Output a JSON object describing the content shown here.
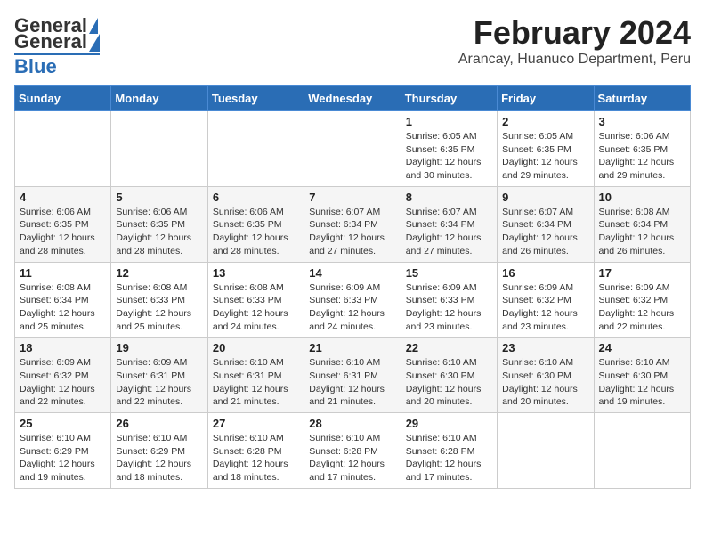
{
  "logo": {
    "general": "General",
    "blue": "Blue"
  },
  "title": "February 2024",
  "subtitle": "Arancay, Huanuco Department, Peru",
  "days_header": [
    "Sunday",
    "Monday",
    "Tuesday",
    "Wednesday",
    "Thursday",
    "Friday",
    "Saturday"
  ],
  "weeks": [
    [
      {
        "day": "",
        "detail": ""
      },
      {
        "day": "",
        "detail": ""
      },
      {
        "day": "",
        "detail": ""
      },
      {
        "day": "",
        "detail": ""
      },
      {
        "day": "1",
        "detail": "Sunrise: 6:05 AM\nSunset: 6:35 PM\nDaylight: 12 hours\nand 30 minutes."
      },
      {
        "day": "2",
        "detail": "Sunrise: 6:05 AM\nSunset: 6:35 PM\nDaylight: 12 hours\nand 29 minutes."
      },
      {
        "day": "3",
        "detail": "Sunrise: 6:06 AM\nSunset: 6:35 PM\nDaylight: 12 hours\nand 29 minutes."
      }
    ],
    [
      {
        "day": "4",
        "detail": "Sunrise: 6:06 AM\nSunset: 6:35 PM\nDaylight: 12 hours\nand 28 minutes."
      },
      {
        "day": "5",
        "detail": "Sunrise: 6:06 AM\nSunset: 6:35 PM\nDaylight: 12 hours\nand 28 minutes."
      },
      {
        "day": "6",
        "detail": "Sunrise: 6:06 AM\nSunset: 6:35 PM\nDaylight: 12 hours\nand 28 minutes."
      },
      {
        "day": "7",
        "detail": "Sunrise: 6:07 AM\nSunset: 6:34 PM\nDaylight: 12 hours\nand 27 minutes."
      },
      {
        "day": "8",
        "detail": "Sunrise: 6:07 AM\nSunset: 6:34 PM\nDaylight: 12 hours\nand 27 minutes."
      },
      {
        "day": "9",
        "detail": "Sunrise: 6:07 AM\nSunset: 6:34 PM\nDaylight: 12 hours\nand 26 minutes."
      },
      {
        "day": "10",
        "detail": "Sunrise: 6:08 AM\nSunset: 6:34 PM\nDaylight: 12 hours\nand 26 minutes."
      }
    ],
    [
      {
        "day": "11",
        "detail": "Sunrise: 6:08 AM\nSunset: 6:34 PM\nDaylight: 12 hours\nand 25 minutes."
      },
      {
        "day": "12",
        "detail": "Sunrise: 6:08 AM\nSunset: 6:33 PM\nDaylight: 12 hours\nand 25 minutes."
      },
      {
        "day": "13",
        "detail": "Sunrise: 6:08 AM\nSunset: 6:33 PM\nDaylight: 12 hours\nand 24 minutes."
      },
      {
        "day": "14",
        "detail": "Sunrise: 6:09 AM\nSunset: 6:33 PM\nDaylight: 12 hours\nand 24 minutes."
      },
      {
        "day": "15",
        "detail": "Sunrise: 6:09 AM\nSunset: 6:33 PM\nDaylight: 12 hours\nand 23 minutes."
      },
      {
        "day": "16",
        "detail": "Sunrise: 6:09 AM\nSunset: 6:32 PM\nDaylight: 12 hours\nand 23 minutes."
      },
      {
        "day": "17",
        "detail": "Sunrise: 6:09 AM\nSunset: 6:32 PM\nDaylight: 12 hours\nand 22 minutes."
      }
    ],
    [
      {
        "day": "18",
        "detail": "Sunrise: 6:09 AM\nSunset: 6:32 PM\nDaylight: 12 hours\nand 22 minutes."
      },
      {
        "day": "19",
        "detail": "Sunrise: 6:09 AM\nSunset: 6:31 PM\nDaylight: 12 hours\nand 22 minutes."
      },
      {
        "day": "20",
        "detail": "Sunrise: 6:10 AM\nSunset: 6:31 PM\nDaylight: 12 hours\nand 21 minutes."
      },
      {
        "day": "21",
        "detail": "Sunrise: 6:10 AM\nSunset: 6:31 PM\nDaylight: 12 hours\nand 21 minutes."
      },
      {
        "day": "22",
        "detail": "Sunrise: 6:10 AM\nSunset: 6:30 PM\nDaylight: 12 hours\nand 20 minutes."
      },
      {
        "day": "23",
        "detail": "Sunrise: 6:10 AM\nSunset: 6:30 PM\nDaylight: 12 hours\nand 20 minutes."
      },
      {
        "day": "24",
        "detail": "Sunrise: 6:10 AM\nSunset: 6:30 PM\nDaylight: 12 hours\nand 19 minutes."
      }
    ],
    [
      {
        "day": "25",
        "detail": "Sunrise: 6:10 AM\nSunset: 6:29 PM\nDaylight: 12 hours\nand 19 minutes."
      },
      {
        "day": "26",
        "detail": "Sunrise: 6:10 AM\nSunset: 6:29 PM\nDaylight: 12 hours\nand 18 minutes."
      },
      {
        "day": "27",
        "detail": "Sunrise: 6:10 AM\nSunset: 6:28 PM\nDaylight: 12 hours\nand 18 minutes."
      },
      {
        "day": "28",
        "detail": "Sunrise: 6:10 AM\nSunset: 6:28 PM\nDaylight: 12 hours\nand 17 minutes."
      },
      {
        "day": "29",
        "detail": "Sunrise: 6:10 AM\nSunset: 6:28 PM\nDaylight: 12 hours\nand 17 minutes."
      },
      {
        "day": "",
        "detail": ""
      },
      {
        "day": "",
        "detail": ""
      }
    ]
  ]
}
